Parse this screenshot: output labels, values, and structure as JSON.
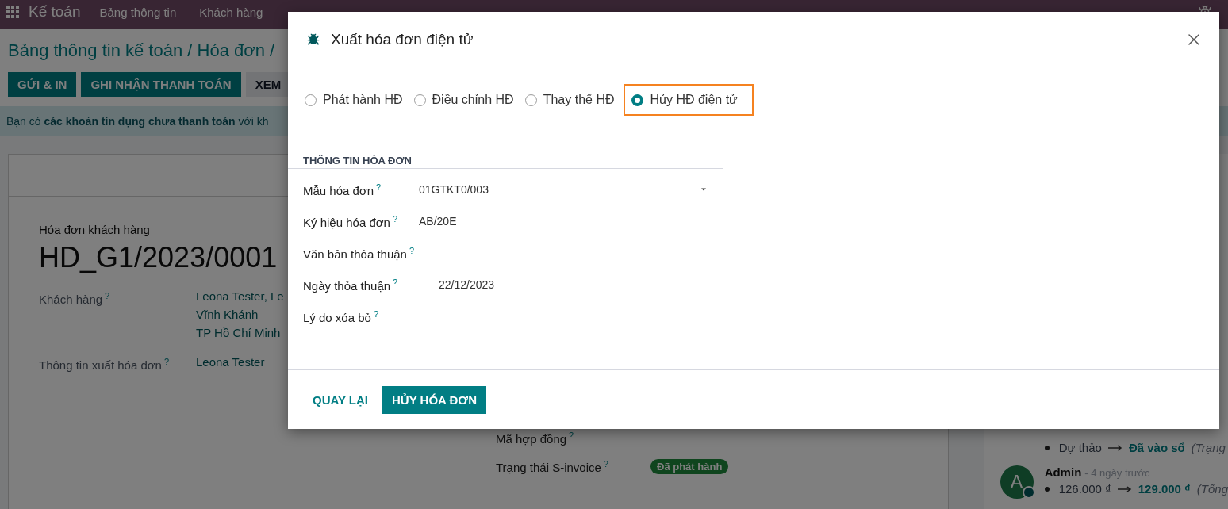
{
  "navbar": {
    "app_name": "Kế toán",
    "menu": [
      "Bảng thông tin",
      "Khách hàng"
    ]
  },
  "breadcrumb": "Bảng thông tin kế toán / Hóa đơn /",
  "action_buttons": [
    {
      "label": "GỬI & IN",
      "kind": "primary"
    },
    {
      "label": "GHI NHẬN THANH TOÁN",
      "kind": "primary"
    },
    {
      "label": "XEM",
      "kind": "secondary"
    }
  ],
  "alert": "Bạn có **các khoản tín dụng chưa thanh toán** với kh",
  "invoice": {
    "type_label": "Hóa đơn khách hàng",
    "number": "HD_G1/2023/0001",
    "fields": [
      {
        "label": "Khách hàng",
        "help": "?",
        "lines": [
          "Leona Tester, Le",
          "Vĩnh Khánh",
          "TP Hồ Chí Minh"
        ]
      },
      {
        "label": "Thông tin xuất hóa đơn",
        "help": "?",
        "lines": [
          "Leona Tester"
        ]
      }
    ],
    "right_fields": [
      {
        "label": "Mã hợp đồng",
        "help": "?"
      },
      {
        "label": "Trạng thái S-invoice",
        "help": "?",
        "badge": "Đã phát hành"
      }
    ]
  },
  "chatter": {
    "changes": [
      {
        "from": "Dự thảo",
        "to": "Đã vào sổ",
        "note": "(Trạng"
      }
    ],
    "message": {
      "avatar": "A",
      "author": "Admin",
      "time": "- 4 ngày trước",
      "changes": [
        {
          "from": "126.000 ₫",
          "to": "129.000 ₫",
          "note": "(Tổng"
        }
      ]
    }
  },
  "dialog": {
    "title": "Xuất hóa đơn điện tử",
    "options": [
      {
        "label": "Phát hành HĐ",
        "selected": false,
        "highlighted": false
      },
      {
        "label": "Điều chỉnh HĐ",
        "selected": false,
        "highlighted": false
      },
      {
        "label": "Thay thế HĐ",
        "selected": false,
        "highlighted": false
      },
      {
        "label": "Hủy HĐ điện tử",
        "selected": true,
        "highlighted": true
      }
    ],
    "section_title": "THÔNG TIN HÓA ĐƠN",
    "fields": [
      {
        "label": "Mẫu hóa đơn",
        "help": "?",
        "kind": "select",
        "value": "01GTKT0/003"
      },
      {
        "label": "Ký hiệu hóa đơn",
        "help": "?",
        "kind": "text",
        "value": "AB/20E"
      },
      {
        "label": "Văn bản thỏa thuận",
        "help": "?",
        "kind": "text"
      },
      {
        "label": "Ngày thỏa thuận",
        "help": "?",
        "kind": "date",
        "value": "22/12/2023"
      },
      {
        "label": "Lý do xóa bỏ",
        "help": "?",
        "kind": "text"
      }
    ],
    "buttons": [
      {
        "label": "QUAY LẠI",
        "kind": "link"
      },
      {
        "label": "HỦY HÓA ĐƠN",
        "kind": "primary"
      }
    ]
  }
}
